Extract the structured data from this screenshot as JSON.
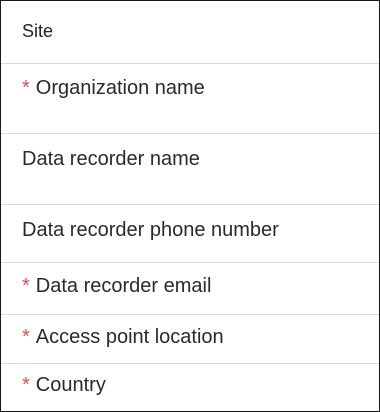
{
  "section": {
    "title": "Site"
  },
  "fields": [
    {
      "label": "Organization name",
      "required": true,
      "required_mark": "*"
    },
    {
      "label": "Data recorder name",
      "required": false,
      "required_mark": ""
    },
    {
      "label": "Data recorder phone number",
      "required": false,
      "required_mark": ""
    },
    {
      "label": "Data recorder email",
      "required": true,
      "required_mark": "*"
    },
    {
      "label": "Access point location",
      "required": true,
      "required_mark": "*"
    },
    {
      "label": "Country",
      "required": true,
      "required_mark": "*"
    }
  ],
  "colors": {
    "required_mark": "#d9534f",
    "divider": "#dcdcdc",
    "text": "#2a2a2a"
  }
}
